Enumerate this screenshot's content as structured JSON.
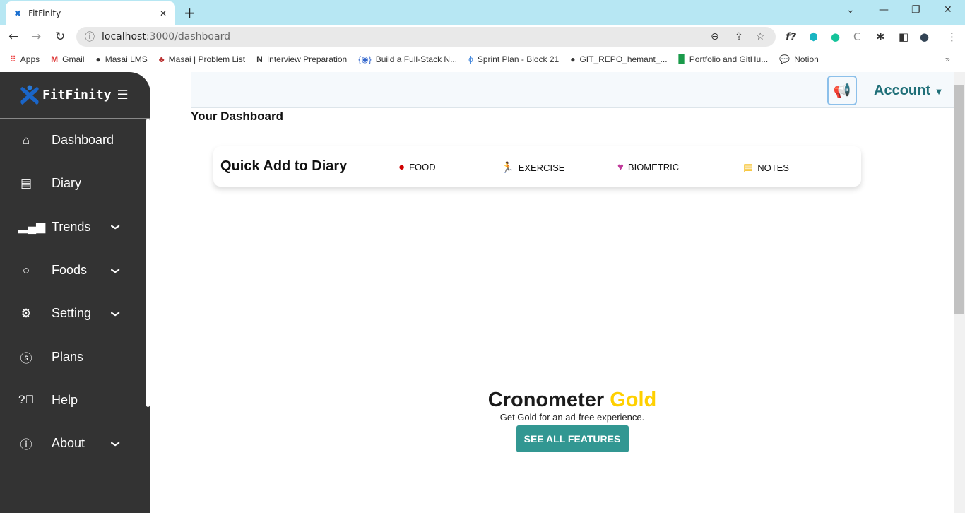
{
  "browser": {
    "tab_title": "FitFinity",
    "url_host": "localhost",
    "url_path": ":3000/dashboard",
    "bookmarks": [
      {
        "icon": "apps-icon",
        "label": "Apps"
      },
      {
        "icon": "gmail-icon",
        "label": "Gmail"
      },
      {
        "icon": "globe-icon",
        "label": "Masai LMS"
      },
      {
        "icon": "pin-icon",
        "label": "Masai | Problem List"
      },
      {
        "icon": "notion-icon",
        "label": "Interview Preparation"
      },
      {
        "icon": "code-icon",
        "label": "Build a Full-Stack N..."
      },
      {
        "icon": "sprint-icon",
        "label": "Sprint Plan - Block 21"
      },
      {
        "icon": "github-icon",
        "label": "GIT_REPO_hemant_..."
      },
      {
        "icon": "sheets-icon",
        "label": "Portfolio and GitHu..."
      },
      {
        "icon": "chat-icon",
        "label": "Notion"
      }
    ]
  },
  "sidebar": {
    "brand": "FitFinity",
    "items": [
      {
        "label": "Dashboard",
        "icon": "home-icon",
        "expandable": false
      },
      {
        "label": "Diary",
        "icon": "diary-icon",
        "expandable": false
      },
      {
        "label": "Trends",
        "icon": "bar-chart-icon",
        "expandable": true
      },
      {
        "label": "Foods",
        "icon": "apple-icon",
        "expandable": true
      },
      {
        "label": "Setting",
        "icon": "gear-icon",
        "expandable": true
      },
      {
        "label": "Plans",
        "icon": "dollar-icon",
        "expandable": false
      },
      {
        "label": "Help",
        "icon": "help-icon",
        "expandable": false
      },
      {
        "label": "About",
        "icon": "info-icon",
        "expandable": true
      }
    ]
  },
  "header": {
    "account_label": "Account"
  },
  "main": {
    "title": "Your Dashboard",
    "quick_add": {
      "heading": "Quick Add to Diary",
      "actions": [
        {
          "label": "FOOD",
          "icon": "apple-add-icon",
          "color": "#d00000"
        },
        {
          "label": "EXERCISE",
          "icon": "runner-add-icon",
          "color": "#19b5c2"
        },
        {
          "label": "BIOMETRIC",
          "icon": "heart-add-icon",
          "color": "#c0399a"
        },
        {
          "label": "NOTES",
          "icon": "note-add-icon",
          "color": "#f5b70a"
        }
      ]
    },
    "promo": {
      "brand": "Cronometer",
      "gold": "Gold",
      "subtitle": "Get Gold for an ad-free experience.",
      "button": "SEE ALL FEATURES"
    }
  },
  "colors": {
    "sidebar": "#333333",
    "accent": "#329792",
    "gold": "#ffd000",
    "account": "#1f6f78"
  }
}
